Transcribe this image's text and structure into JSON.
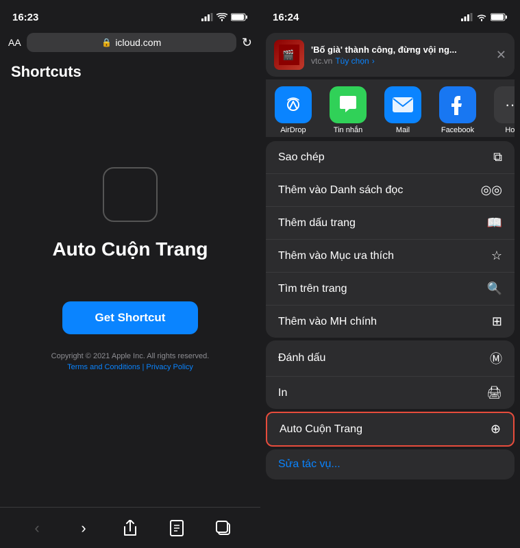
{
  "left": {
    "time": "16:23",
    "url": "icloud.com",
    "aa_label": "AA",
    "shortcuts_title": "Shortcuts",
    "shortcut_name": "Auto Cuộn Trang",
    "get_shortcut_btn": "Get Shortcut",
    "copyright_line1": "Copyright © 2021 Apple Inc. All rights reserved.",
    "copyright_links": "Terms and Conditions | Privacy Policy"
  },
  "right": {
    "time": "16:24",
    "notif_title": "'Bố già' thành công, đừng vội ng...",
    "notif_source": "vtc.vn",
    "notif_option": "Tùy chọn",
    "apps": [
      {
        "label": "AirDrop",
        "type": "airdrop"
      },
      {
        "label": "Tin nhắn",
        "type": "messages"
      },
      {
        "label": "Mail",
        "type": "mail"
      },
      {
        "label": "Facebook",
        "type": "facebook"
      }
    ],
    "menu_items_1": [
      {
        "label": "Sao chép",
        "icon": "copy"
      },
      {
        "label": "Thêm vào Danh sách đọc",
        "icon": "glasses"
      },
      {
        "label": "Thêm dấu trang",
        "icon": "book"
      },
      {
        "label": "Thêm vào Mục ưa thích",
        "icon": "star"
      },
      {
        "label": "Tìm trên trang",
        "icon": "search"
      },
      {
        "label": "Thêm vào MH chính",
        "icon": "plus-square"
      }
    ],
    "menu_items_2": [
      {
        "label": "Đánh dấu",
        "icon": "markup"
      },
      {
        "label": "In",
        "icon": "print"
      }
    ],
    "highlighted_item": {
      "label": "Auto Cuộn Trang",
      "icon": "move"
    },
    "edit_action": "Sửa tác vụ..."
  }
}
